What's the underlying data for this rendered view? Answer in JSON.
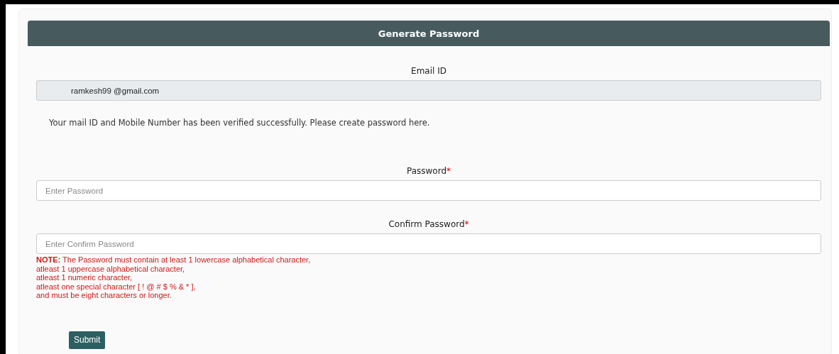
{
  "header": {
    "title": "Generate Password"
  },
  "email": {
    "label": "Email ID",
    "value": "ramkesh99 @gmail.com",
    "disabled": true
  },
  "message": "Your mail ID and Mobile Number has been verified successfully. Please create password here.",
  "fields": [
    {
      "label": "Password",
      "required_mark": "*",
      "placeholder": "Enter Password"
    },
    {
      "label": "Confirm Password",
      "required_mark": "*",
      "placeholder": "Enter Confirm Password"
    }
  ],
  "note": [
    "**NOTE:**  The Password must contain at least 1 lowercase alphabetical character,",
    "atleast 1 uppercase alphabetical character,",
    "atleast 1 numeric character,",
    "atleast one special character [ ! @ # $ % & * ],",
    "and must be eight characters or longer."
  ],
  "submit": "Submit"
}
